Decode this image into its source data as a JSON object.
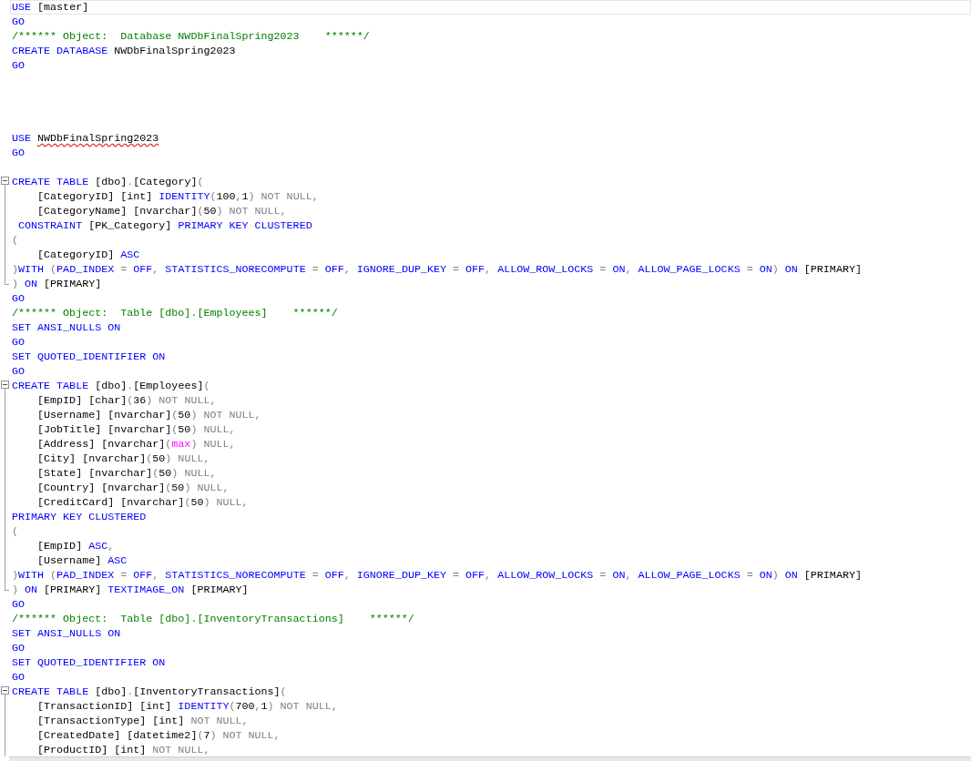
{
  "editor": {
    "blocks": [
      {
        "collapsible": false,
        "lines": [
          {
            "current": true,
            "tokens": [
              {
                "kind": "keyword",
                "text": "USE "
              },
              {
                "kind": "plain",
                "text": "[master]"
              }
            ]
          },
          {
            "current": false,
            "tokens": [
              {
                "kind": "keyword",
                "text": "GO"
              }
            ]
          },
          {
            "current": false,
            "tokens": [
              {
                "kind": "comment",
                "text": "/****** Object:  Database NWDbFinalSpring2023    ******/"
              }
            ]
          },
          {
            "current": false,
            "tokens": [
              {
                "kind": "keyword",
                "text": "CREATE DATABASE "
              },
              {
                "kind": "plain",
                "text": "NWDbFinalSpring2023"
              }
            ]
          },
          {
            "current": false,
            "tokens": [
              {
                "kind": "keyword",
                "text": "GO"
              }
            ]
          },
          {
            "current": false
          },
          {
            "current": false
          },
          {
            "current": false
          },
          {
            "current": false
          },
          {
            "current": false,
            "tokens": [
              {
                "kind": "keyword",
                "text": "USE "
              },
              {
                "kind": "misspelled",
                "text": "NWDbFinalSpring2023"
              }
            ]
          },
          {
            "current": false,
            "tokens": [
              {
                "kind": "keyword",
                "text": "GO"
              }
            ]
          },
          {
            "current": false
          }
        ]
      },
      {
        "collapsible": true,
        "ends": true,
        "lines": [
          {
            "current": false,
            "tokens": [
              {
                "kind": "keyword",
                "text": "CREATE TABLE "
              },
              {
                "kind": "plain",
                "text": "[dbo]"
              },
              {
                "kind": "operator",
                "text": "."
              },
              {
                "kind": "plain",
                "text": "[Category]"
              },
              {
                "kind": "operator",
                "text": "("
              }
            ]
          },
          {
            "current": false,
            "tokens": [
              {
                "kind": "plain",
                "text": "    [CategoryID] [int] "
              },
              {
                "kind": "keyword",
                "text": "IDENTITY"
              },
              {
                "kind": "operator",
                "text": "("
              },
              {
                "kind": "plain",
                "text": "100"
              },
              {
                "kind": "operator",
                "text": ","
              },
              {
                "kind": "plain",
                "text": "1"
              },
              {
                "kind": "operator",
                "text": ") NOT NULL,"
              }
            ]
          },
          {
            "current": false,
            "tokens": [
              {
                "kind": "plain",
                "text": "    [CategoryName] [nvarchar]"
              },
              {
                "kind": "operator",
                "text": "("
              },
              {
                "kind": "plain",
                "text": "50"
              },
              {
                "kind": "operator",
                "text": ") NOT NULL,"
              }
            ]
          },
          {
            "current": false,
            "tokens": [
              {
                "kind": "keyword",
                "text": " CONSTRAINT "
              },
              {
                "kind": "plain",
                "text": "[PK_Category] "
              },
              {
                "kind": "keyword",
                "text": "PRIMARY KEY CLUSTERED"
              }
            ]
          },
          {
            "current": false,
            "tokens": [
              {
                "kind": "operator",
                "text": "("
              }
            ]
          },
          {
            "current": false,
            "tokens": [
              {
                "kind": "plain",
                "text": "    [CategoryID] "
              },
              {
                "kind": "keyword",
                "text": "ASC"
              }
            ]
          },
          {
            "current": false,
            "tokens": [
              {
                "kind": "operator",
                "text": ")"
              },
              {
                "kind": "keyword",
                "text": "WITH "
              },
              {
                "kind": "operator",
                "text": "("
              },
              {
                "kind": "keyword",
                "text": "PAD_INDEX "
              },
              {
                "kind": "operator",
                "text": "= "
              },
              {
                "kind": "keyword",
                "text": "OFF"
              },
              {
                "kind": "operator",
                "text": ", "
              },
              {
                "kind": "keyword",
                "text": "STATISTICS_NORECOMPUTE "
              },
              {
                "kind": "operator",
                "text": "= "
              },
              {
                "kind": "keyword",
                "text": "OFF"
              },
              {
                "kind": "operator",
                "text": ", "
              },
              {
                "kind": "keyword",
                "text": "IGNORE_DUP_KEY "
              },
              {
                "kind": "operator",
                "text": "= "
              },
              {
                "kind": "keyword",
                "text": "OFF"
              },
              {
                "kind": "operator",
                "text": ", "
              },
              {
                "kind": "keyword",
                "text": "ALLOW_ROW_LOCKS "
              },
              {
                "kind": "operator",
                "text": "= "
              },
              {
                "kind": "keyword",
                "text": "ON"
              },
              {
                "kind": "operator",
                "text": ", "
              },
              {
                "kind": "keyword",
                "text": "ALLOW_PAGE_LOCKS "
              },
              {
                "kind": "operator",
                "text": "= "
              },
              {
                "kind": "keyword",
                "text": "ON"
              },
              {
                "kind": "operator",
                "text": ") "
              },
              {
                "kind": "keyword",
                "text": "ON "
              },
              {
                "kind": "plain",
                "text": "[PRIMARY]"
              }
            ]
          },
          {
            "current": false,
            "tokens": [
              {
                "kind": "operator",
                "text": ") "
              },
              {
                "kind": "keyword",
                "text": "ON "
              },
              {
                "kind": "plain",
                "text": "[PRIMARY]"
              }
            ]
          }
        ]
      },
      {
        "collapsible": false,
        "lines": [
          {
            "current": false,
            "tokens": [
              {
                "kind": "keyword",
                "text": "GO"
              }
            ]
          },
          {
            "current": false,
            "tokens": [
              {
                "kind": "comment",
                "text": "/****** Object:  Table [dbo].[Employees]    ******/"
              }
            ]
          },
          {
            "current": false,
            "tokens": [
              {
                "kind": "keyword",
                "text": "SET ANSI_NULLS ON"
              }
            ]
          },
          {
            "current": false,
            "tokens": [
              {
                "kind": "keyword",
                "text": "GO"
              }
            ]
          },
          {
            "current": false,
            "tokens": [
              {
                "kind": "keyword",
                "text": "SET QUOTED_IDENTIFIER ON"
              }
            ]
          },
          {
            "current": false,
            "tokens": [
              {
                "kind": "keyword",
                "text": "GO"
              }
            ]
          }
        ]
      },
      {
        "collapsible": true,
        "ends": true,
        "lines": [
          {
            "current": false,
            "tokens": [
              {
                "kind": "keyword",
                "text": "CREATE TABLE "
              },
              {
                "kind": "plain",
                "text": "[dbo]"
              },
              {
                "kind": "operator",
                "text": "."
              },
              {
                "kind": "plain",
                "text": "[Employees]"
              },
              {
                "kind": "operator",
                "text": "("
              }
            ]
          },
          {
            "current": false,
            "tokens": [
              {
                "kind": "plain",
                "text": "    [EmpID] [char]"
              },
              {
                "kind": "operator",
                "text": "("
              },
              {
                "kind": "plain",
                "text": "36"
              },
              {
                "kind": "operator",
                "text": ") NOT NULL,"
              }
            ]
          },
          {
            "current": false,
            "tokens": [
              {
                "kind": "plain",
                "text": "    [Username] [nvarchar]"
              },
              {
                "kind": "operator",
                "text": "("
              },
              {
                "kind": "plain",
                "text": "50"
              },
              {
                "kind": "operator",
                "text": ") NOT NULL,"
              }
            ]
          },
          {
            "current": false,
            "tokens": [
              {
                "kind": "plain",
                "text": "    [JobTitle] [nvarchar]"
              },
              {
                "kind": "operator",
                "text": "("
              },
              {
                "kind": "plain",
                "text": "50"
              },
              {
                "kind": "operator",
                "text": ") NULL,"
              }
            ]
          },
          {
            "current": false,
            "tokens": [
              {
                "kind": "plain",
                "text": "    [Address] [nvarchar]"
              },
              {
                "kind": "operator",
                "text": "("
              },
              {
                "kind": "function",
                "text": "max"
              },
              {
                "kind": "operator",
                "text": ") NULL,"
              }
            ]
          },
          {
            "current": false,
            "tokens": [
              {
                "kind": "plain",
                "text": "    [City] [nvarchar]"
              },
              {
                "kind": "operator",
                "text": "("
              },
              {
                "kind": "plain",
                "text": "50"
              },
              {
                "kind": "operator",
                "text": ") NULL,"
              }
            ]
          },
          {
            "current": false,
            "tokens": [
              {
                "kind": "plain",
                "text": "    [State] [nvarchar]"
              },
              {
                "kind": "operator",
                "text": "("
              },
              {
                "kind": "plain",
                "text": "50"
              },
              {
                "kind": "operator",
                "text": ") NULL,"
              }
            ]
          },
          {
            "current": false,
            "tokens": [
              {
                "kind": "plain",
                "text": "    [Country] [nvarchar]"
              },
              {
                "kind": "operator",
                "text": "("
              },
              {
                "kind": "plain",
                "text": "50"
              },
              {
                "kind": "operator",
                "text": ") NULL,"
              }
            ]
          },
          {
            "current": false,
            "tokens": [
              {
                "kind": "plain",
                "text": "    [CreditCard] [nvarchar]"
              },
              {
                "kind": "operator",
                "text": "("
              },
              {
                "kind": "plain",
                "text": "50"
              },
              {
                "kind": "operator",
                "text": ") NULL,"
              }
            ]
          },
          {
            "current": false,
            "tokens": [
              {
                "kind": "keyword",
                "text": "PRIMARY KEY CLUSTERED"
              }
            ]
          },
          {
            "current": false,
            "tokens": [
              {
                "kind": "operator",
                "text": "("
              }
            ]
          },
          {
            "current": false,
            "tokens": [
              {
                "kind": "plain",
                "text": "    [EmpID] "
              },
              {
                "kind": "keyword",
                "text": "ASC"
              },
              {
                "kind": "operator",
                "text": ","
              }
            ]
          },
          {
            "current": false,
            "tokens": [
              {
                "kind": "plain",
                "text": "    [Username] "
              },
              {
                "kind": "keyword",
                "text": "ASC"
              }
            ]
          },
          {
            "current": false,
            "tokens": [
              {
                "kind": "operator",
                "text": ")"
              },
              {
                "kind": "keyword",
                "text": "WITH "
              },
              {
                "kind": "operator",
                "text": "("
              },
              {
                "kind": "keyword",
                "text": "PAD_INDEX "
              },
              {
                "kind": "operator",
                "text": "= "
              },
              {
                "kind": "keyword",
                "text": "OFF"
              },
              {
                "kind": "operator",
                "text": ", "
              },
              {
                "kind": "keyword",
                "text": "STATISTICS_NORECOMPUTE "
              },
              {
                "kind": "operator",
                "text": "= "
              },
              {
                "kind": "keyword",
                "text": "OFF"
              },
              {
                "kind": "operator",
                "text": ", "
              },
              {
                "kind": "keyword",
                "text": "IGNORE_DUP_KEY "
              },
              {
                "kind": "operator",
                "text": "= "
              },
              {
                "kind": "keyword",
                "text": "OFF"
              },
              {
                "kind": "operator",
                "text": ", "
              },
              {
                "kind": "keyword",
                "text": "ALLOW_ROW_LOCKS "
              },
              {
                "kind": "operator",
                "text": "= "
              },
              {
                "kind": "keyword",
                "text": "ON"
              },
              {
                "kind": "operator",
                "text": ", "
              },
              {
                "kind": "keyword",
                "text": "ALLOW_PAGE_LOCKS "
              },
              {
                "kind": "operator",
                "text": "= "
              },
              {
                "kind": "keyword",
                "text": "ON"
              },
              {
                "kind": "operator",
                "text": ") "
              },
              {
                "kind": "keyword",
                "text": "ON "
              },
              {
                "kind": "plain",
                "text": "[PRIMARY]"
              }
            ]
          },
          {
            "current": false,
            "tokens": [
              {
                "kind": "operator",
                "text": ") "
              },
              {
                "kind": "keyword",
                "text": "ON "
              },
              {
                "kind": "plain",
                "text": "[PRIMARY] "
              },
              {
                "kind": "keyword",
                "text": "TEXTIMAGE_ON "
              },
              {
                "kind": "plain",
                "text": "[PRIMARY]"
              }
            ]
          }
        ]
      },
      {
        "collapsible": false,
        "lines": [
          {
            "current": false,
            "tokens": [
              {
                "kind": "keyword",
                "text": "GO"
              }
            ]
          },
          {
            "current": false,
            "tokens": [
              {
                "kind": "comment",
                "text": "/****** Object:  Table [dbo].[InventoryTransactions]    ******/"
              }
            ]
          },
          {
            "current": false,
            "tokens": [
              {
                "kind": "keyword",
                "text": "SET ANSI_NULLS ON"
              }
            ]
          },
          {
            "current": false,
            "tokens": [
              {
                "kind": "keyword",
                "text": "GO"
              }
            ]
          },
          {
            "current": false,
            "tokens": [
              {
                "kind": "keyword",
                "text": "SET QUOTED_IDENTIFIER ON"
              }
            ]
          },
          {
            "current": false,
            "tokens": [
              {
                "kind": "keyword",
                "text": "GO"
              }
            ]
          }
        ]
      },
      {
        "collapsible": true,
        "ends": false,
        "lines": [
          {
            "current": false,
            "tokens": [
              {
                "kind": "keyword",
                "text": "CREATE TABLE "
              },
              {
                "kind": "plain",
                "text": "[dbo]"
              },
              {
                "kind": "operator",
                "text": "."
              },
              {
                "kind": "plain",
                "text": "[InventoryTransactions]"
              },
              {
                "kind": "operator",
                "text": "("
              }
            ]
          },
          {
            "current": false,
            "tokens": [
              {
                "kind": "plain",
                "text": "    [TransactionID] [int] "
              },
              {
                "kind": "keyword",
                "text": "IDENTITY"
              },
              {
                "kind": "operator",
                "text": "("
              },
              {
                "kind": "plain",
                "text": "700"
              },
              {
                "kind": "operator",
                "text": ","
              },
              {
                "kind": "plain",
                "text": "1"
              },
              {
                "kind": "operator",
                "text": ") NOT NULL,"
              }
            ]
          },
          {
            "current": false,
            "tokens": [
              {
                "kind": "plain",
                "text": "    [TransactionType] [int] "
              },
              {
                "kind": "operator",
                "text": "NOT NULL,"
              }
            ]
          },
          {
            "current": false,
            "tokens": [
              {
                "kind": "plain",
                "text": "    [CreatedDate] [datetime2]"
              },
              {
                "kind": "operator",
                "text": "("
              },
              {
                "kind": "plain",
                "text": "7"
              },
              {
                "kind": "operator",
                "text": ") NOT NULL,"
              }
            ]
          },
          {
            "current": false,
            "tokens": [
              {
                "kind": "plain",
                "text": "    [ProductID] [int] "
              },
              {
                "kind": "operator",
                "text": "NOT NULL,"
              }
            ]
          }
        ]
      }
    ]
  }
}
